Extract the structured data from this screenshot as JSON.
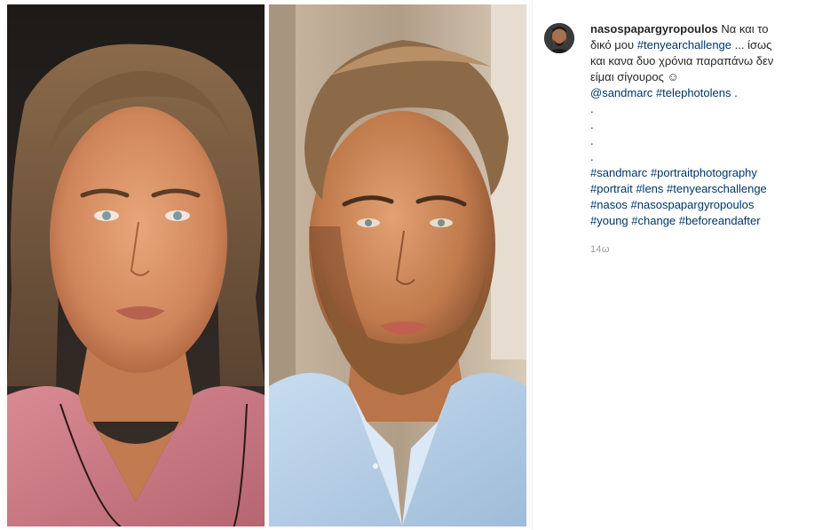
{
  "post": {
    "username": "nasospapargyropoulos",
    "caption_intro": "Να και το",
    "caption_line2_pre": "δικό μου",
    "tag_tenyearchallenge": "#tenyearchallenge",
    "caption_line2_post": "... ίσως",
    "caption_line3": "και κανα δυο χρόνια παραπάνω δεν",
    "caption_line4": "είμαι σίγουρος ☺",
    "mention_sandmarc": "@sandmarc",
    "tag_telephotolens": "#telephotolens",
    "caption_line5_post": " .",
    "dots": [
      ".",
      ".",
      ".",
      "."
    ],
    "hashtags": {
      "line1": [
        "#sandmarc",
        "#portraitphotography"
      ],
      "line2": [
        "#portrait",
        "#lens",
        "#tenyearschallenge"
      ],
      "line3": [
        "#nasos",
        "#nasospapargyropoulos"
      ],
      "line4": [
        "#young",
        "#change",
        "#beforeandafter"
      ]
    },
    "timestamp": "14ω"
  },
  "colors": {
    "link": "#003569",
    "text": "#262626",
    "muted": "#999999"
  }
}
